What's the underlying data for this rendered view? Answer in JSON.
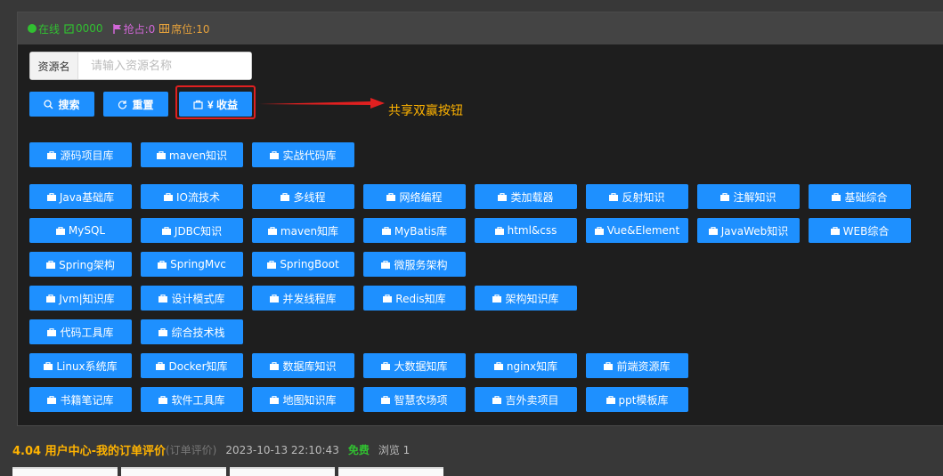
{
  "header": {
    "online": "在线",
    "count": "0000",
    "grab": "抢占:0",
    "seat": "席位:10"
  },
  "search": {
    "label": "资源名",
    "placeholder": "请输入资源名称",
    "search_label": "搜索",
    "reset_label": "重置",
    "profit_label": "¥ 收益"
  },
  "annotation": "共享双赢按钮",
  "tag_rows": [
    [
      "源码项目库",
      "maven知识",
      "实战代码库"
    ],
    [
      "Java基础库",
      "IO流技术",
      "多线程",
      "网络编程",
      "类加载器",
      "反射知识",
      "注解知识",
      "基础综合"
    ],
    [
      "MySQL",
      "JDBC知识",
      "maven知库",
      "MyBatis库",
      "html&css",
      "Vue&Element",
      "JavaWeb知识",
      "WEB综合"
    ],
    [
      "Spring架构",
      "SpringMvc",
      "SpringBoot",
      "微服务架构"
    ],
    [
      "Jvm|知识库",
      "设计模式库",
      "并发线程库",
      "Redis知库",
      "架构知识库"
    ],
    [
      "代码工具库",
      "综合技术栈"
    ],
    [
      "Linux系统库",
      "Docker知库",
      "数据库知识",
      "大数据知库",
      "nginx知库",
      "前端资源库"
    ],
    [
      "书籍笔记库",
      "软件工具库",
      "地图知识库",
      "智慧农场项",
      "吉外卖项目",
      "ppt模板库"
    ]
  ],
  "footer": {
    "title": "4.04 用户中心-我的订单评价",
    "subtitle": "(订单评价)",
    "time": "2023-10-13 22:10:43",
    "free": "免费",
    "views": "浏览 1"
  },
  "colors": {
    "accent": "#1e90ff",
    "online": "#31c031",
    "grab": "#d267d8",
    "seat": "#e6a23c",
    "annotation": "#ffb300",
    "highlight": "#e02020"
  }
}
